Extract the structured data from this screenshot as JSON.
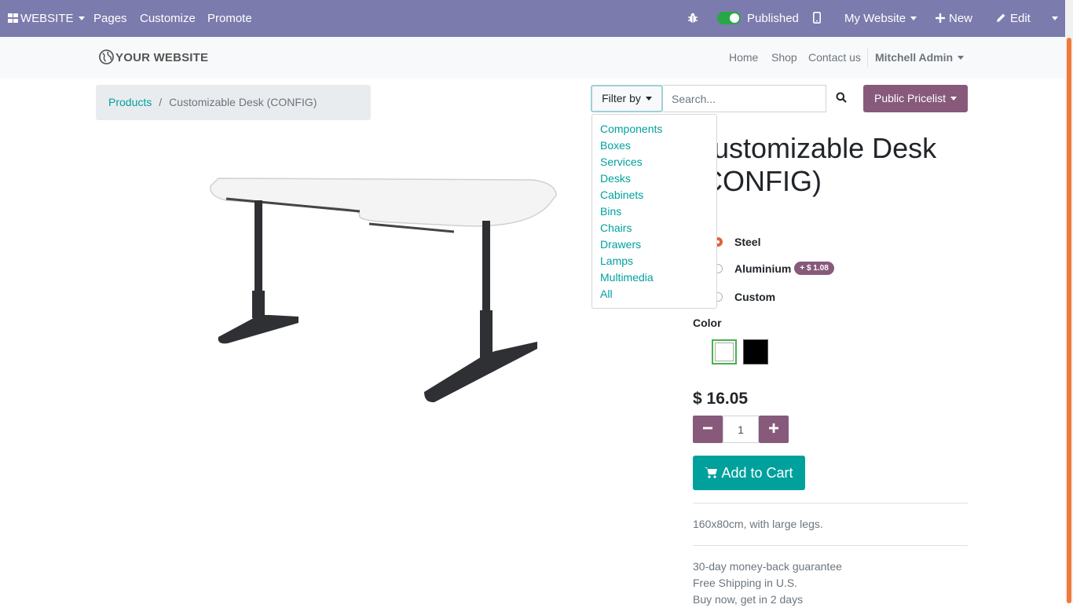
{
  "adminbar": {
    "website_label": "WEBSITE",
    "pages": "Pages",
    "customize": "Customize",
    "promote": "Promote",
    "published": "Published",
    "site_selector": "My Website",
    "new_label": "New",
    "edit_label": "Edit"
  },
  "header": {
    "logo_text": "YOUR WEBSITE",
    "nav": [
      "Home",
      "Shop",
      "Contact us"
    ],
    "user": "Mitchell Admin"
  },
  "breadcrumb": {
    "parent": "Products",
    "separator": "/",
    "current": "Customizable Desk (CONFIG)"
  },
  "search": {
    "filter_label": "Filter by",
    "placeholder": "Search...",
    "pricelist": "Public Pricelist"
  },
  "filter_dropdown": {
    "items": [
      "Components",
      "Boxes",
      "Services",
      "Desks",
      "Cabinets",
      "Bins",
      "Chairs",
      "Drawers",
      "Lamps",
      "Multimedia",
      "All"
    ]
  },
  "product": {
    "title_line1": "Customizable Desk",
    "title_line2": "(CONFIG)",
    "legs_options": [
      {
        "label": "Steel",
        "checked": true
      },
      {
        "label": "Aluminium",
        "badge": "+ $ 1.08",
        "checked": false
      },
      {
        "label": "Custom",
        "checked": false
      }
    ],
    "color_label": "Color",
    "colors": [
      {
        "name": "White",
        "hex": "#ffffff",
        "selected": true
      },
      {
        "name": "Black",
        "hex": "#000000",
        "selected": false
      }
    ],
    "price": "$ 16.05",
    "quantity": "1",
    "add_to_cart": "Add to Cart",
    "description": "160x80cm, with large legs.",
    "terms": [
      "30-day money-back guarantee",
      "Free Shipping in U.S.",
      "Buy now, get in 2 days"
    ]
  },
  "colors": {
    "admin_bar": "#7c7bad",
    "primary": "#875a7b",
    "accent": "#00a09d"
  }
}
